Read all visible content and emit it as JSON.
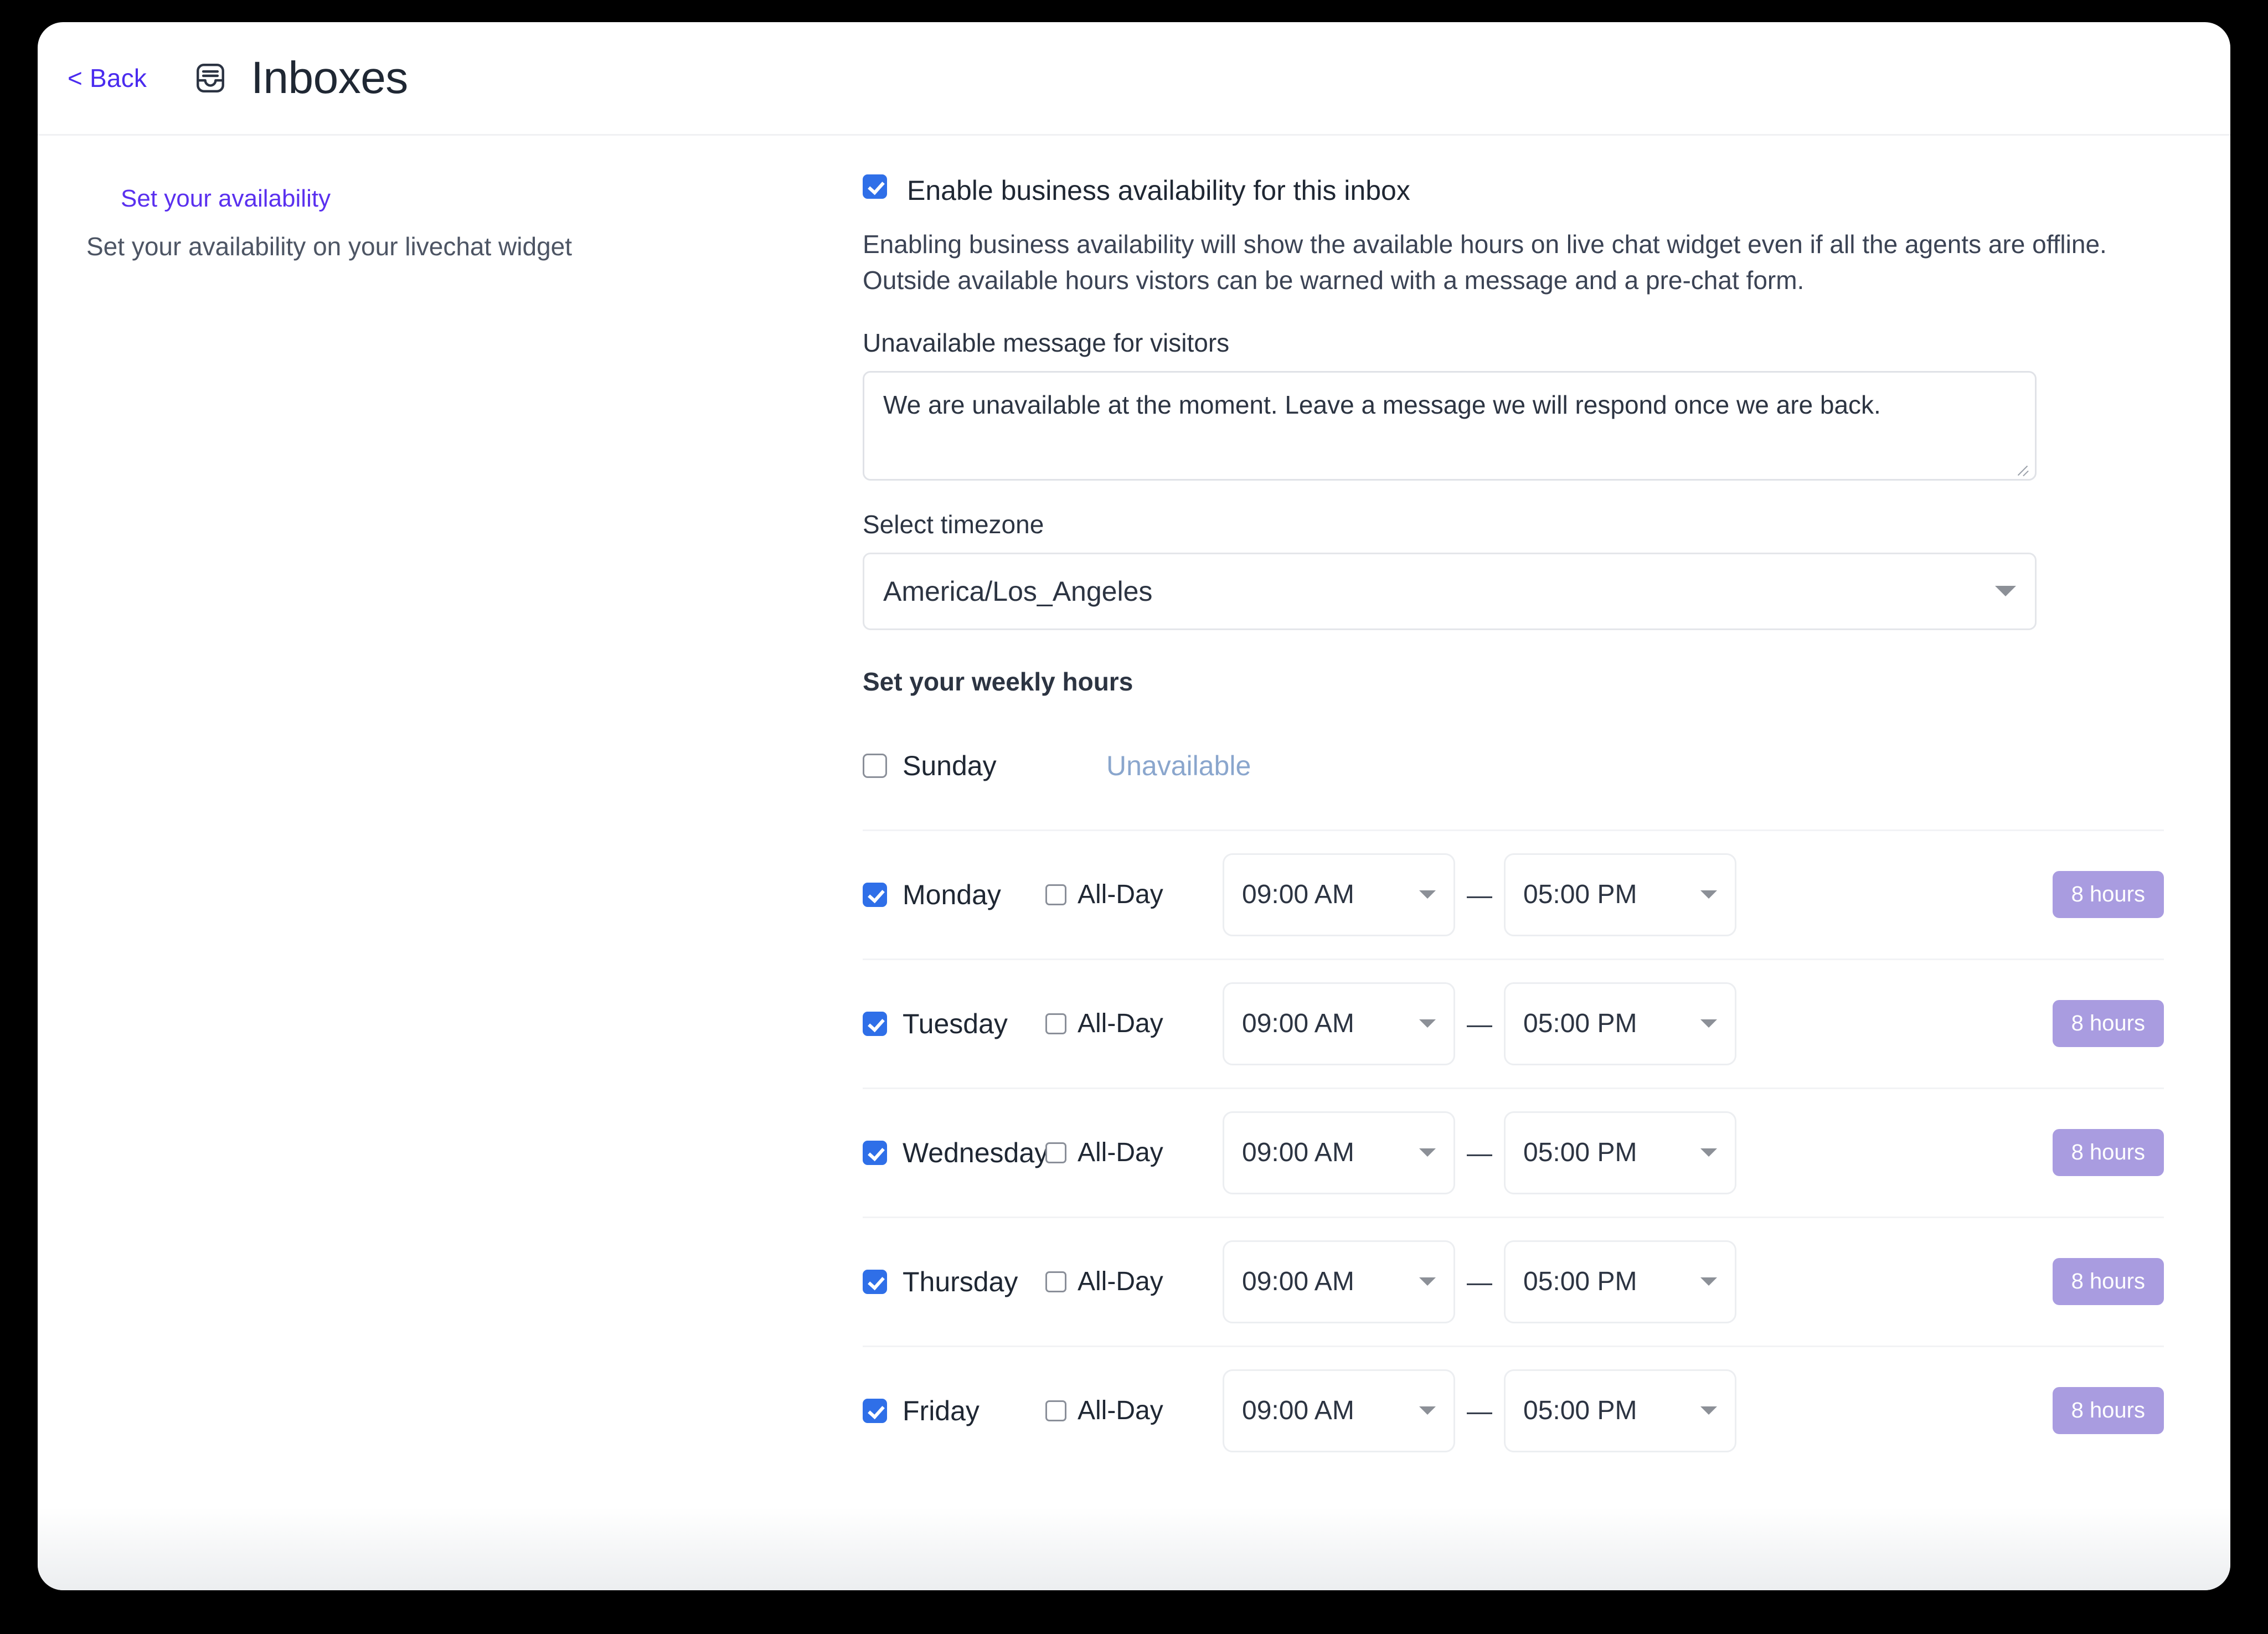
{
  "header": {
    "back_label": "< Back",
    "title": "Inboxes",
    "icon": "inbox-icon"
  },
  "sidebar": {
    "title": "Set your availability",
    "subtitle": "Set your availability on your livechat widget"
  },
  "main": {
    "enable_checkbox_label": "Enable business availability for this inbox",
    "enable_checkbox_checked": true,
    "description": "Enabling business availability will show the available hours on live chat widget even if all the agents are offline. Outside available hours vistors can be warned with a message and a pre-chat form.",
    "unavailable_message_label": "Unavailable message for visitors",
    "unavailable_message_value": "We are unavailable at the moment. Leave a message we will respond once we are back.",
    "timezone_label": "Select timezone",
    "timezone_value": "America/Los_Angeles",
    "weekly_hours_title": "Set your weekly hours",
    "all_day_label": "All-Day",
    "unavailable_text": "Unavailable",
    "dash": "—",
    "days": [
      {
        "name": "Sunday",
        "enabled": false,
        "all_day": false,
        "start": "",
        "end": "",
        "duration": "",
        "unavailable": "Unavailable"
      },
      {
        "name": "Monday",
        "enabled": true,
        "all_day": false,
        "start": "09:00 AM",
        "end": "05:00 PM",
        "duration": "8 hours",
        "unavailable": ""
      },
      {
        "name": "Tuesday",
        "enabled": true,
        "all_day": false,
        "start": "09:00 AM",
        "end": "05:00 PM",
        "duration": "8 hours",
        "unavailable": ""
      },
      {
        "name": "Wednesday",
        "enabled": true,
        "all_day": false,
        "start": "09:00 AM",
        "end": "05:00 PM",
        "duration": "8 hours",
        "unavailable": ""
      },
      {
        "name": "Thursday",
        "enabled": true,
        "all_day": false,
        "start": "09:00 AM",
        "end": "05:00 PM",
        "duration": "8 hours",
        "unavailable": ""
      },
      {
        "name": "Friday",
        "enabled": true,
        "all_day": false,
        "start": "09:00 AM",
        "end": "05:00 PM",
        "duration": "8 hours",
        "unavailable": ""
      }
    ]
  },
  "colors": {
    "accent_purple": "#4a2bef",
    "checkbox_blue": "#2f6fe8",
    "badge_purple": "#a99ce0",
    "unavailable_blue": "#8aa6cd",
    "text_dark": "#1f2733"
  }
}
